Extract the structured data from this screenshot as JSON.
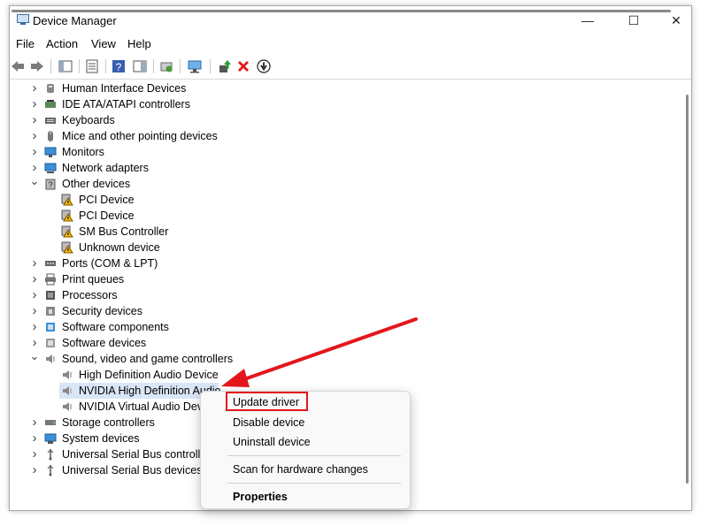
{
  "window": {
    "title": "Device Manager",
    "controls": {
      "minimize": "—",
      "maximize": "☐",
      "close": "✕"
    }
  },
  "menubar": {
    "items": [
      "File",
      "Action",
      "View",
      "Help"
    ]
  },
  "tree": {
    "items": [
      {
        "label": "Human Interface Devices",
        "icon": "hid-icon",
        "expanded": false
      },
      {
        "label": "IDE ATA/ATAPI controllers",
        "icon": "ide-controller-icon",
        "expanded": false
      },
      {
        "label": "Keyboards",
        "icon": "keyboard-icon",
        "expanded": false
      },
      {
        "label": "Mice and other pointing devices",
        "icon": "mouse-icon",
        "expanded": false
      },
      {
        "label": "Monitors",
        "icon": "monitor-icon",
        "expanded": false
      },
      {
        "label": "Network adapters",
        "icon": "network-adapter-icon",
        "expanded": false
      },
      {
        "label": "Other devices",
        "icon": "other-devices-icon",
        "expanded": true
      },
      {
        "label": "PCI Device",
        "icon": "warning-device-icon",
        "child": true
      },
      {
        "label": "PCI Device",
        "icon": "warning-device-icon",
        "child": true
      },
      {
        "label": "SM Bus Controller",
        "icon": "warning-device-icon",
        "child": true
      },
      {
        "label": "Unknown device",
        "icon": "warning-device-icon",
        "child": true
      },
      {
        "label": "Ports (COM & LPT)",
        "icon": "port-icon",
        "expanded": false
      },
      {
        "label": "Print queues",
        "icon": "printer-icon",
        "expanded": false
      },
      {
        "label": "Processors",
        "icon": "processor-icon",
        "expanded": false
      },
      {
        "label": "Security devices",
        "icon": "security-device-icon",
        "expanded": false
      },
      {
        "label": "Software components",
        "icon": "software-component-icon",
        "expanded": false
      },
      {
        "label": "Software devices",
        "icon": "software-device-icon",
        "expanded": false
      },
      {
        "label": "Sound, video and game controllers",
        "icon": "speaker-icon",
        "expanded": true
      },
      {
        "label": "High Definition Audio Device",
        "icon": "speaker-icon",
        "child": true
      },
      {
        "label": "NVIDIA High Definition Audio",
        "icon": "speaker-icon",
        "child": true,
        "selected": true
      },
      {
        "label": "NVIDIA Virtual Audio Devi",
        "icon": "speaker-icon",
        "child": true
      },
      {
        "label": "Storage controllers",
        "icon": "storage-controller-icon",
        "expanded": false
      },
      {
        "label": "System devices",
        "icon": "system-device-icon",
        "expanded": false
      },
      {
        "label": "Universal Serial Bus controller",
        "icon": "usb-icon",
        "expanded": false
      },
      {
        "label": "Universal Serial Bus devices",
        "icon": "usb-icon",
        "expanded": false
      }
    ]
  },
  "context_menu": {
    "update_driver": "Update driver",
    "disable_device": "Disable device",
    "uninstall_device": "Uninstall device",
    "scan_hardware": "Scan for hardware changes",
    "properties": "Properties"
  },
  "colors": {
    "highlight": "#e3161b",
    "selection": "#d9e6f6",
    "warning": "#f2b800"
  }
}
